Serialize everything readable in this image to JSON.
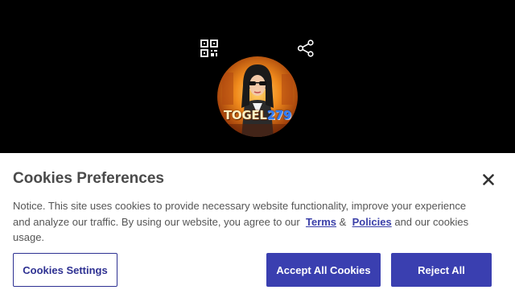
{
  "header": {
    "qr_icon": "qr-code-icon",
    "share_icon": "share-icon",
    "avatar": {
      "brand_part1": "TOGEL",
      "brand_part2": "279"
    }
  },
  "cookies": {
    "title": "Cookies Preferences",
    "close_icon": "close-icon",
    "notice_part1": "Notice. This site uses cookies to provide necessary website functionality, improve your experience and analyze our traffic. By using our website, you agree to our",
    "terms_label": "Terms",
    "amp": "&",
    "policies_label": "Policies",
    "notice_part2": "and our cookies usage.",
    "settings_label": "Cookies Settings",
    "accept_label": "Accept All Cookies",
    "reject_label": "Reject All"
  },
  "colors": {
    "background": "#000000",
    "panel": "#ffffff",
    "accent": "#3a3fb0",
    "link": "#3a3fa8"
  }
}
